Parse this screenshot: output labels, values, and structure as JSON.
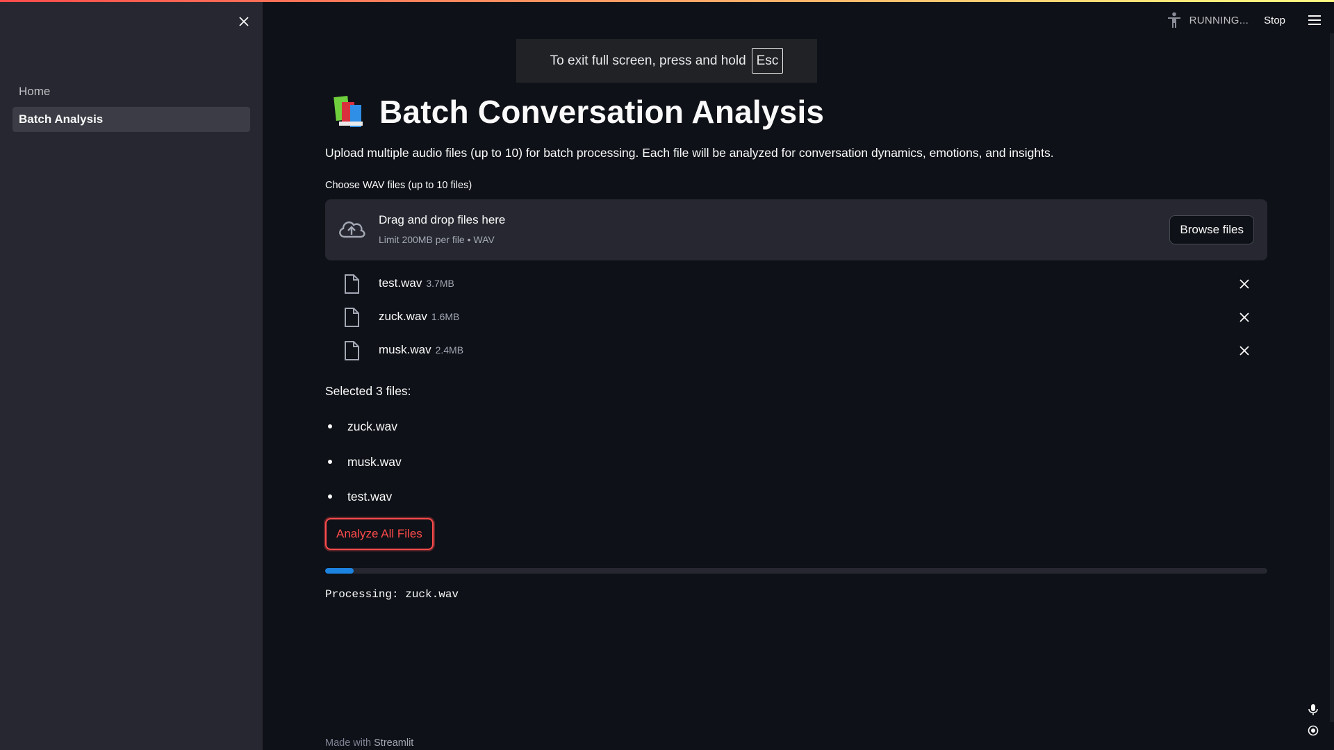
{
  "sidebar": {
    "items": [
      {
        "label": "Home",
        "active": false
      },
      {
        "label": "Batch Analysis",
        "active": true
      }
    ]
  },
  "header": {
    "status_text": "RUNNING...",
    "stop_label": "Stop"
  },
  "overlay": {
    "text": "To exit full screen, press and hold",
    "key": "Esc"
  },
  "main": {
    "title": "Batch Conversation Analysis",
    "description": "Upload multiple audio files (up to 10) for batch processing. Each file will be analyzed for conversation dynamics, emotions, and insights.",
    "uploader": {
      "label": "Choose WAV files (up to 10 files)",
      "drop_title": "Drag and drop files here",
      "drop_sub": "Limit 200MB per file • WAV",
      "browse_label": "Browse files"
    },
    "files": [
      {
        "name": "test.wav",
        "size": "3.7MB"
      },
      {
        "name": "zuck.wav",
        "size": "1.6MB"
      },
      {
        "name": "musk.wav",
        "size": "2.4MB"
      }
    ],
    "selected_label": "Selected 3 files:",
    "selected": [
      "zuck.wav",
      "musk.wav",
      "test.wav"
    ],
    "analyze_label": "Analyze All Files",
    "progress_fraction": 0.03,
    "processing_text": "Processing: zuck.wav"
  },
  "footer": {
    "prefix": "Made with",
    "brand": "Streamlit"
  },
  "colors": {
    "background": "#0e1117",
    "sidebar": "#262730",
    "accent": "#ff4b4b",
    "progress": "#1c83e1"
  }
}
